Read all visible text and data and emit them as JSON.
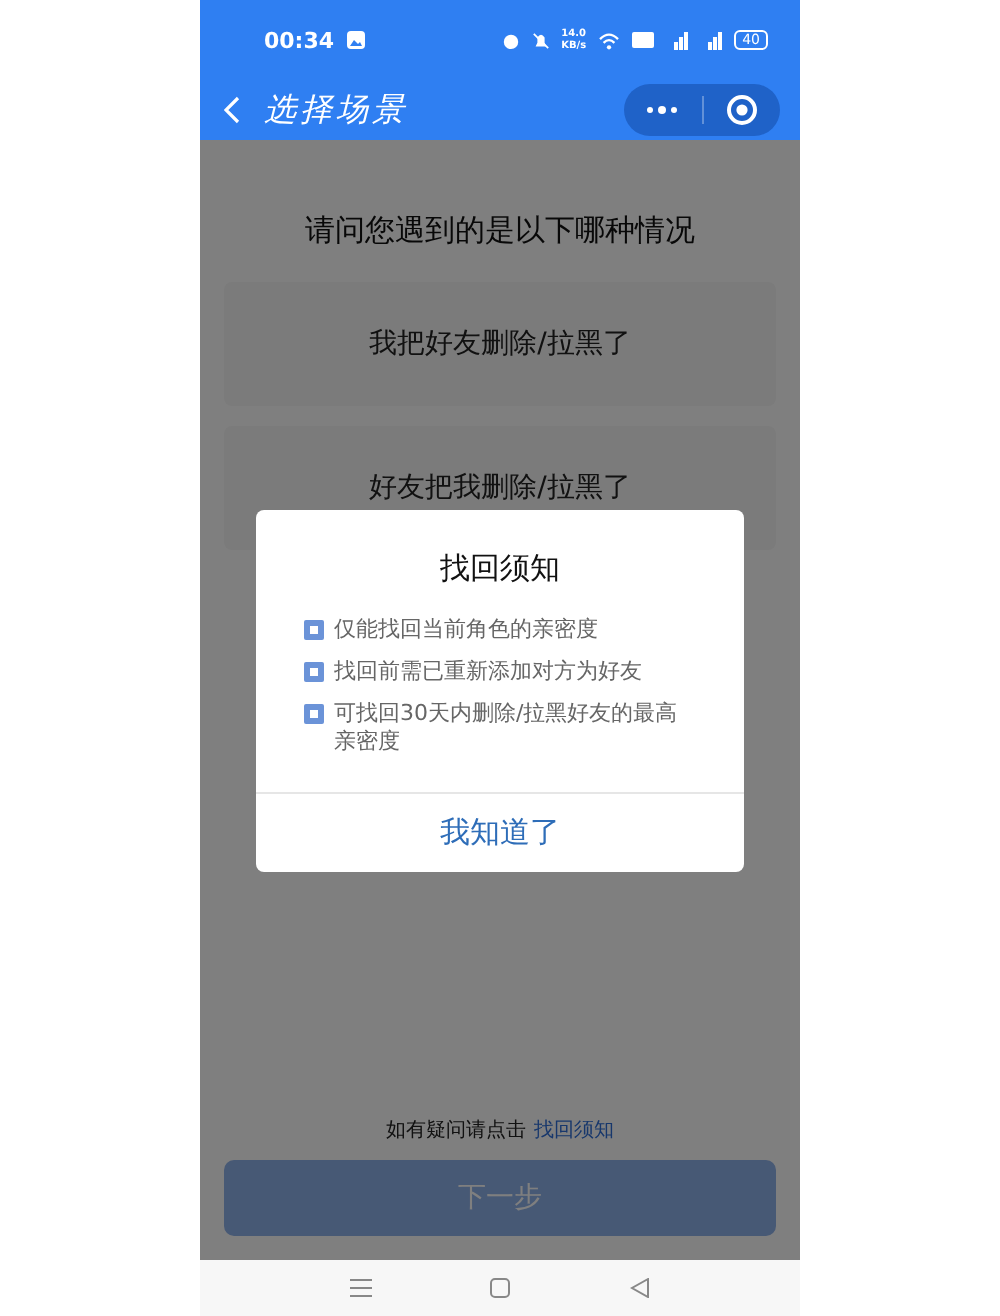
{
  "status_bar": {
    "time": "00:34",
    "speed": "14.0",
    "speed_unit": "KB/s",
    "battery": "40"
  },
  "nav_bar": {
    "title": "选择场景"
  },
  "page": {
    "question": "请问您遇到的是以下哪种情况",
    "options": [
      {
        "label": "我把好友删除/拉黑了"
      },
      {
        "label": "好友把我删除/拉黑了"
      }
    ],
    "help_text": "如有疑问请点击",
    "help_link": "找回须知",
    "next_button": {
      "label": "下一步",
      "disabled": true
    }
  },
  "dialog": {
    "title": "找回须知",
    "items": [
      "仅能找回当前角色的亲密度",
      "找回前需已重新添加对方为好友",
      "可找回30天内删除/拉黑好友的最高亲密度"
    ],
    "button": "我知道了"
  }
}
